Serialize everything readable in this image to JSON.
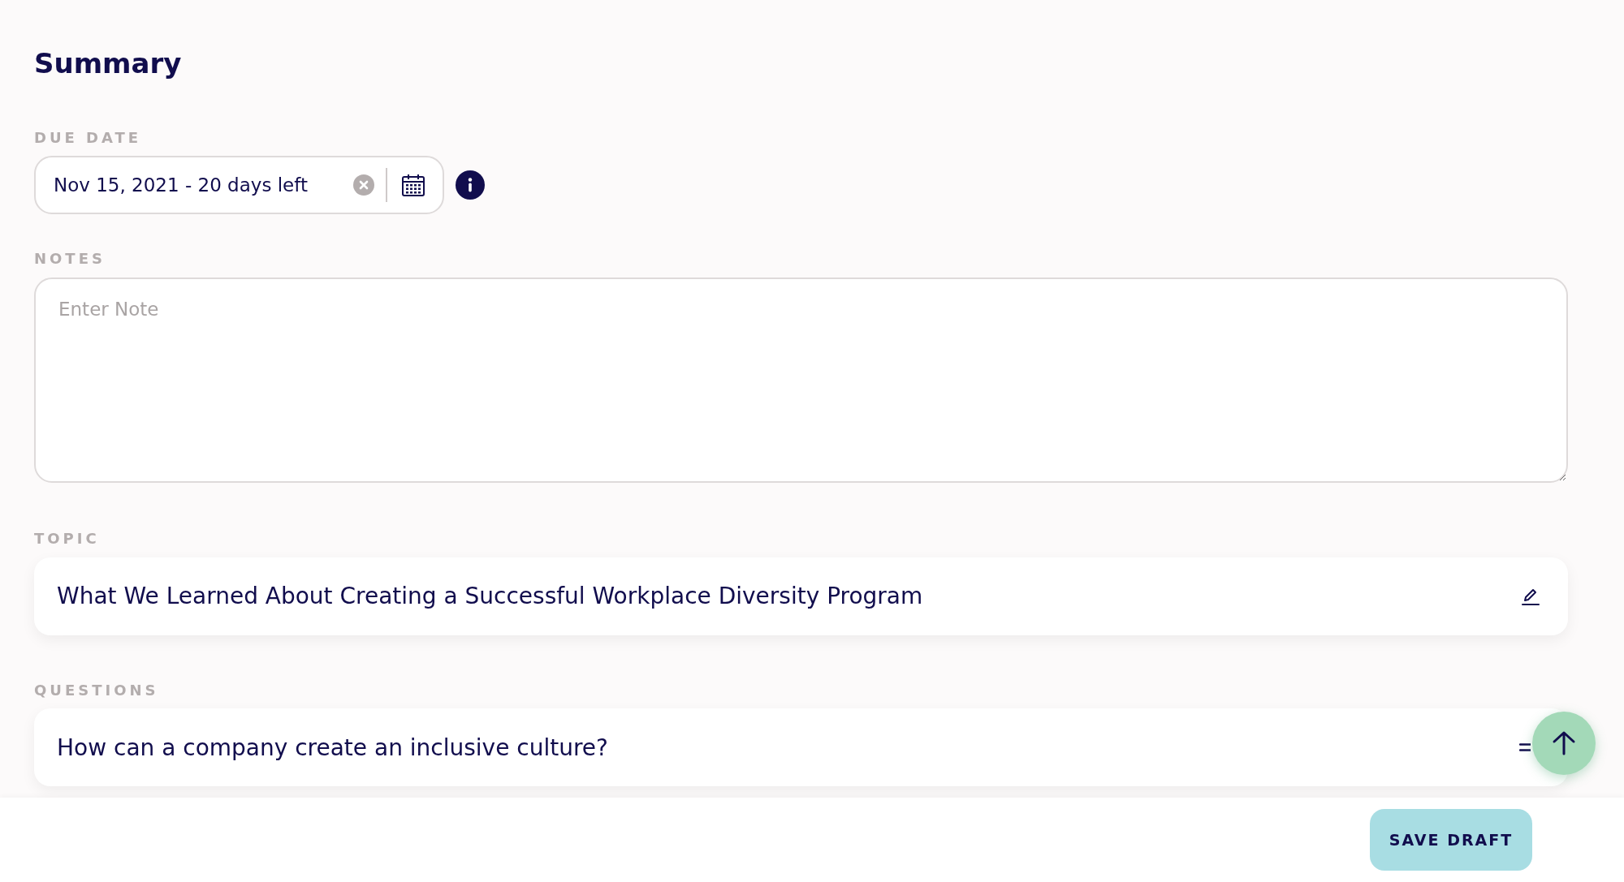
{
  "title": "Summary",
  "due_date": {
    "label": "DUE DATE",
    "value": "Nov 15, 2021 - 20 days left"
  },
  "notes": {
    "label": "NOTES",
    "placeholder": "Enter Note"
  },
  "topic": {
    "label": "TOPIC",
    "text": "What We Learned About Creating a Successful Workplace Diversity Program"
  },
  "questions": {
    "label": "QUESTIONS",
    "items": [
      {
        "text": "How can a company create an inclusive culture?"
      }
    ]
  },
  "footer": {
    "save_button": "SAVE DRAFT"
  }
}
